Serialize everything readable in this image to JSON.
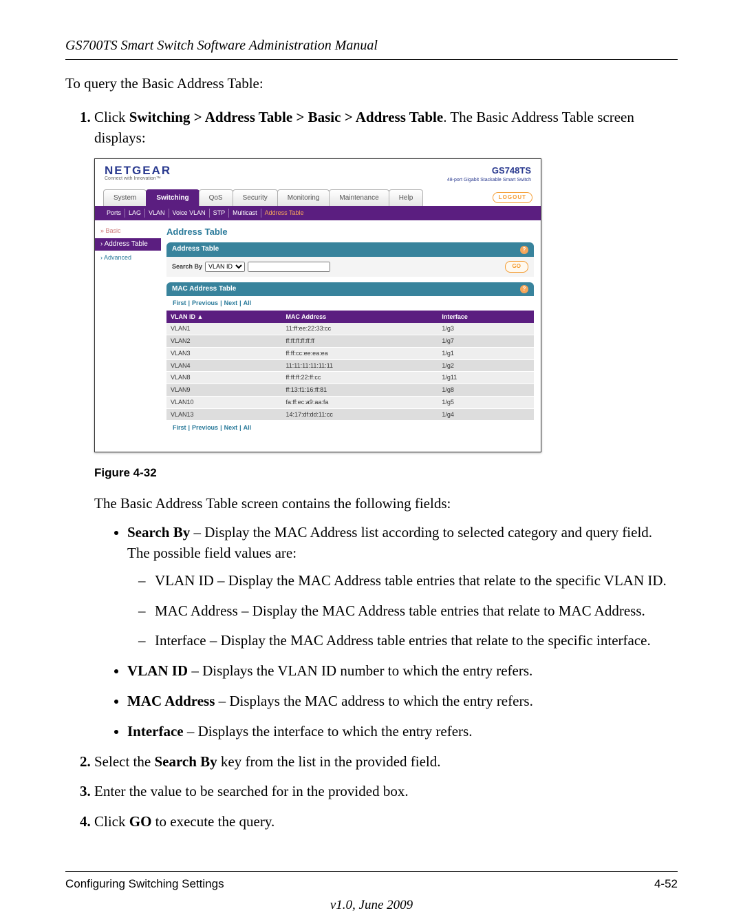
{
  "header": "GS700TS Smart Switch Software Administration Manual",
  "intro": "To query the Basic Address Table:",
  "step1_prefix": "Click ",
  "step1_path": "Switching > Address Table > Basic > Address Table",
  "step1_suffix": ". The Basic Address Table screen displays:",
  "fig_caption": "Figure 4-32",
  "after_fig": "The Basic Address Table screen contains the following fields:",
  "fields": {
    "search_by_label": "Search By",
    "search_by_text": " – Display the MAC Address list according to selected category and query field. The possible field values are:",
    "sb_sub": [
      "VLAN ID – Display the MAC Address table entries that relate to the specific VLAN ID.",
      "MAC Address – Display the MAC Address table entries that relate to MAC Address.",
      "Interface – Display the MAC Address table entries that relate to the specific interface."
    ],
    "vlan_id_label": "VLAN ID",
    "vlan_id_text": " – Displays the VLAN ID number to which the entry refers.",
    "mac_label": "MAC Address",
    "mac_text": " – Displays the MAC address to which the entry refers.",
    "iface_label": "Interface",
    "iface_text": " – Displays the interface to which the entry refers."
  },
  "step2_a": "Select the ",
  "step2_b": "Search By",
  "step2_c": " key from the list in the provided field.",
  "step3": "Enter the value to be searched for in the provided box.",
  "step4_a": "Click ",
  "step4_b": "GO",
  "step4_c": " to execute the query.",
  "footer_left": "Configuring Switching Settings",
  "footer_right": "4-52",
  "version": "v1.0, June 2009",
  "shot": {
    "brand": "NETGEAR",
    "brand_tag": "Connect with Innovation™",
    "model": "GS748TS",
    "model_desc": "48-port Gigabit Stackable Smart Switch",
    "tabs": [
      "System",
      "Switching",
      "QoS",
      "Security",
      "Monitoring",
      "Maintenance",
      "Help"
    ],
    "active_tab": "Switching",
    "logout": "LOGOUT",
    "subnav": [
      "Ports",
      "LAG",
      "VLAN",
      "Voice VLAN",
      "STP",
      "Multicast",
      "Address Table"
    ],
    "side": {
      "basic": "Basic",
      "sel": "Address Table",
      "adv": "Advanced"
    },
    "panel_title": "Address Table",
    "panel1_hd": "Address Table",
    "search_by": "Search By",
    "search_sel": "VLAN ID",
    "go": "GO",
    "panel2_hd": "MAC Address Table",
    "pager": [
      "First",
      "Previous",
      "Next",
      "All"
    ],
    "cols": [
      "VLAN ID",
      "MAC Address",
      "Interface"
    ],
    "rows": [
      {
        "v": "VLAN1",
        "m": "11:ff:ee:22:33:cc",
        "i": "1/g3"
      },
      {
        "v": "VLAN2",
        "m": "ff:ff:ff:ff:ff:ff",
        "i": "1/g7"
      },
      {
        "v": "VLAN3",
        "m": "ff:ff:cc:ee:ea:ea",
        "i": "1/g1"
      },
      {
        "v": "VLAN4",
        "m": "11:11:11:11:11:11",
        "i": "1/g2"
      },
      {
        "v": "VLAN8",
        "m": "ff:ff:ff:22:ff:cc",
        "i": "1/g11"
      },
      {
        "v": "VLAN9",
        "m": "ff:13:f1:16:ff:81",
        "i": "1/g8"
      },
      {
        "v": "VLAN10",
        "m": "fa:ff:ec:a9:aa:fa",
        "i": "1/g5"
      },
      {
        "v": "VLAN13",
        "m": "14:17:df:dd:11:cc",
        "i": "1/g4"
      }
    ]
  }
}
